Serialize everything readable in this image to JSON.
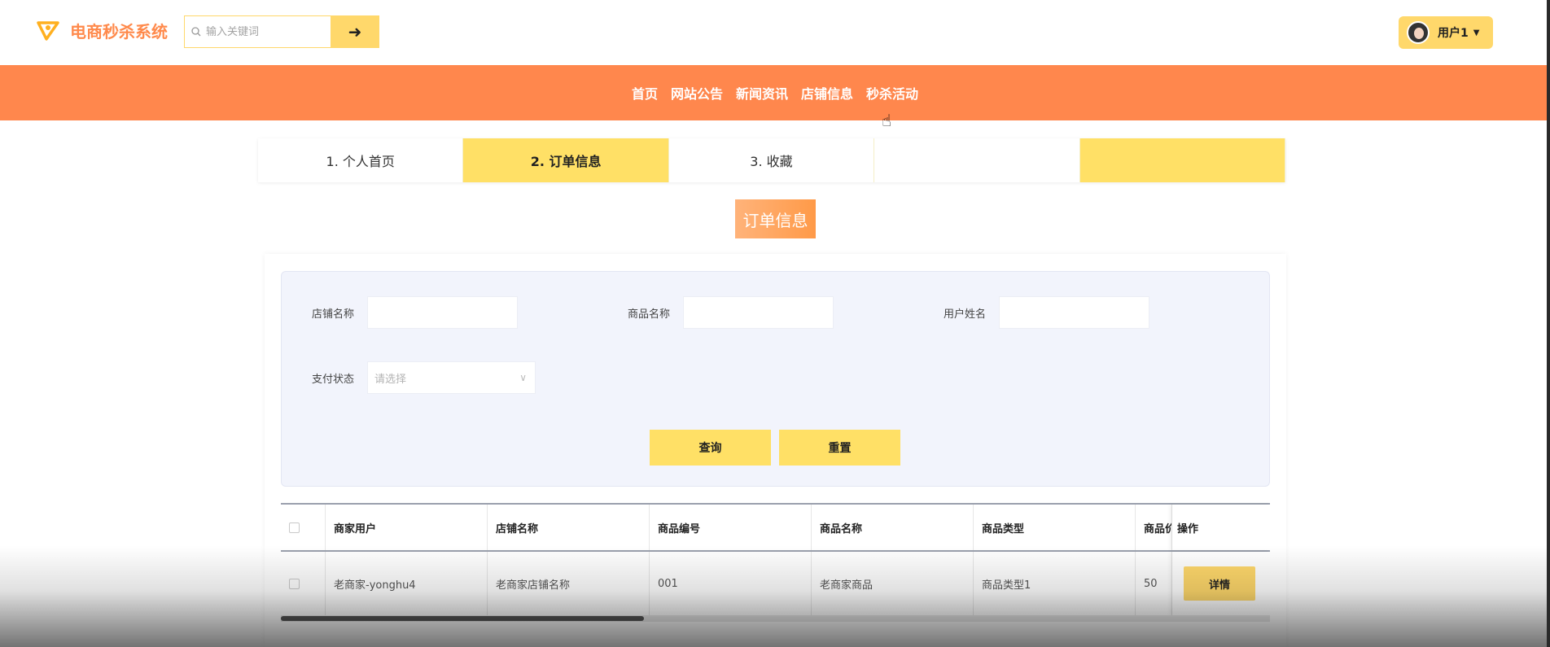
{
  "header": {
    "app_title": "电商秒杀系统",
    "search_placeholder": "输入关键词",
    "user_label": "用户1"
  },
  "nav": {
    "items": [
      "首页",
      "网站公告",
      "新闻资讯",
      "店铺信息",
      "秒杀活动"
    ]
  },
  "steps": [
    {
      "label": "1. 个人首页"
    },
    {
      "label": "2. 订单信息"
    },
    {
      "label": "3. 收藏"
    },
    {
      "label": ""
    },
    {
      "label": ""
    }
  ],
  "page_title": "订单信息",
  "filters": {
    "shop_name_label": "店铺名称",
    "product_name_label": "商品名称",
    "user_name_label": "用户姓名",
    "pay_status_label": "支付状态",
    "pay_status_placeholder": "请选择",
    "query_button": "查询",
    "reset_button": "重置"
  },
  "table": {
    "columns": [
      "商家用户",
      "店铺名称",
      "商品编号",
      "商品名称",
      "商品类型",
      "商品价",
      "操作"
    ],
    "rows": [
      {
        "merchant": "老商家-yonghu4",
        "shop": "老商家店铺名称",
        "code": "001",
        "product": "老商家商品",
        "type": "商品类型1",
        "price": "50",
        "action": "详情"
      }
    ]
  },
  "colors": {
    "accent_orange": "#ff874d",
    "accent_yellow": "#ffe066"
  }
}
